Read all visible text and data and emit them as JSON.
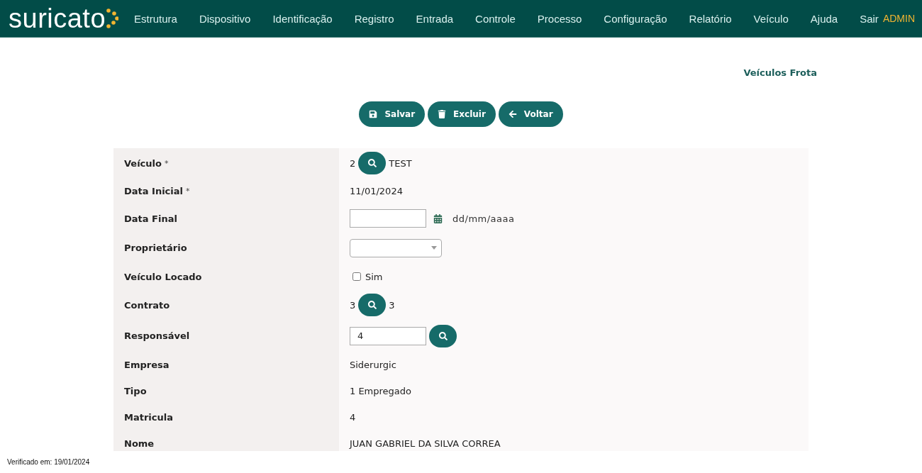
{
  "header": {
    "logo": "suricato",
    "menu": [
      {
        "label": "Estrutura"
      },
      {
        "label": "Dispositivo"
      },
      {
        "label": "Identificação"
      },
      {
        "label": "Registro"
      },
      {
        "label": "Entrada"
      },
      {
        "label": "Controle"
      },
      {
        "label": "Processo"
      },
      {
        "label": "Configuração"
      },
      {
        "label": "Relatório"
      },
      {
        "label": "Veículo"
      },
      {
        "label": "Ajuda"
      },
      {
        "label": "Sair"
      }
    ],
    "user": "ADMIN"
  },
  "page_title": "Veículos Frota",
  "actions": [
    {
      "kind": "save",
      "label": "Salvar"
    },
    {
      "kind": "delete",
      "label": "Excluir"
    },
    {
      "kind": "back",
      "label": "Voltar"
    }
  ],
  "form": [
    {
      "kind": "lookup",
      "label": "Veículo",
      "required": "*",
      "code": "2",
      "value": "TEST"
    },
    {
      "kind": "text",
      "label": "Data Inicial",
      "required": "*",
      "value": "11/01/2024"
    },
    {
      "kind": "date",
      "label": "Data Final",
      "hint": "dd/mm/aaaa"
    },
    {
      "kind": "select",
      "label": "Proprietário"
    },
    {
      "kind": "checkbox",
      "label": "Veículo Locado",
      "option": "Sim",
      "checked": false
    },
    {
      "kind": "lookup",
      "label": "Contrato",
      "code": "3",
      "value": "3"
    },
    {
      "kind": "input-lookup",
      "label": "Responsável",
      "value": "4"
    },
    {
      "kind": "text",
      "label": "Empresa",
      "value": "Siderurgic"
    },
    {
      "kind": "text",
      "label": "Tipo",
      "value": "1 Empregado"
    },
    {
      "kind": "text",
      "label": "Matricula",
      "value": "4"
    },
    {
      "kind": "text",
      "label": "Nome",
      "value": "JUAN GABRIEL DA SILVA CORREA"
    }
  ],
  "footer": "Verificado em: 19/01/2024"
}
